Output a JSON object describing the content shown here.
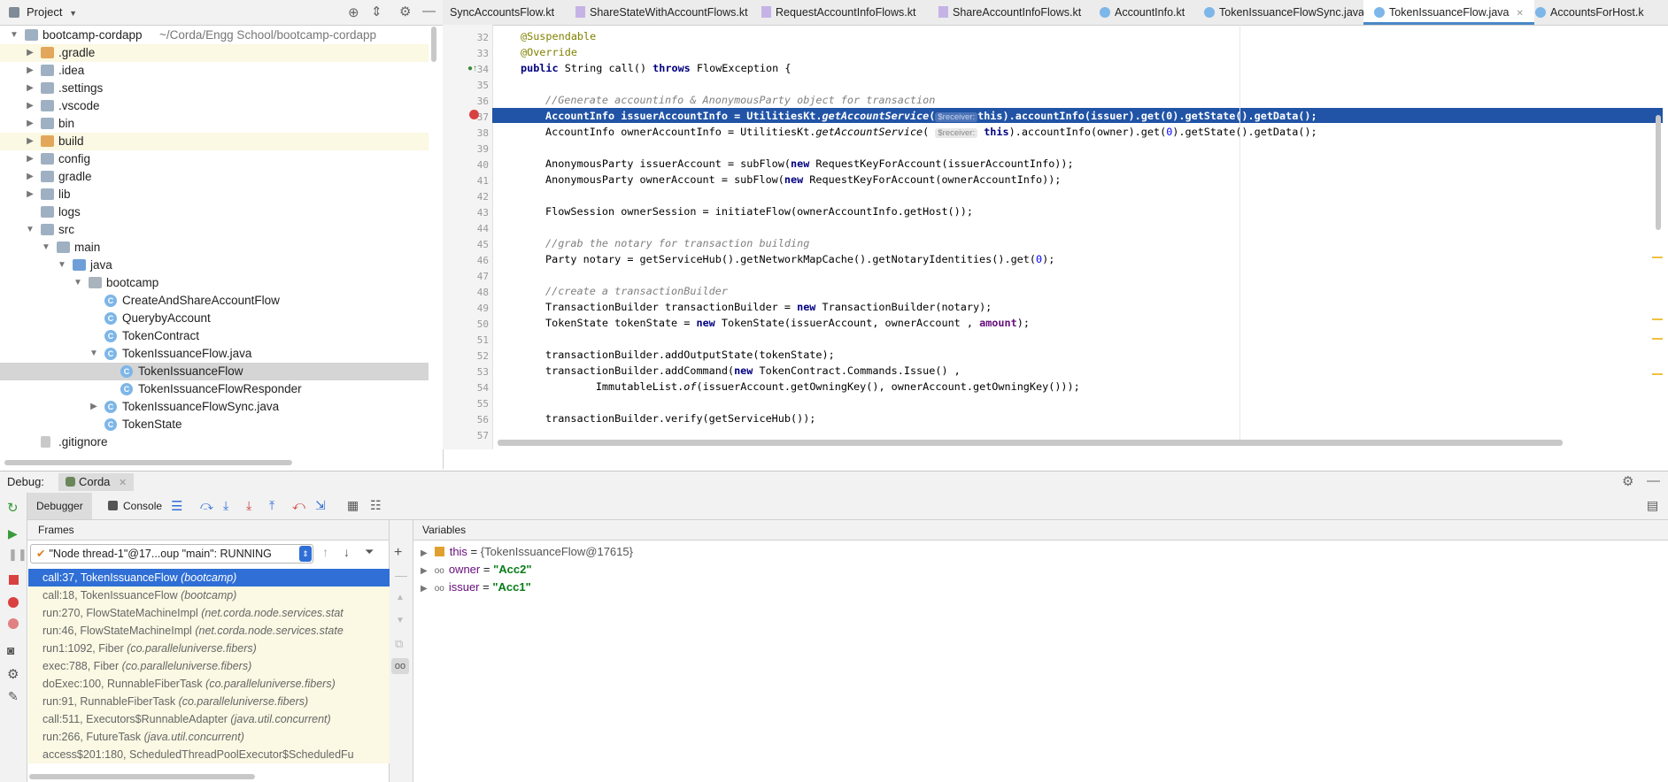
{
  "project": {
    "title": "Project",
    "tree": [
      {
        "label": "bootcamp-cordapp",
        "extra": "~/Corda/Engg School/bootcamp-cordapp",
        "depth": 0,
        "open": true,
        "icon": "folder"
      },
      {
        "label": ".gradle",
        "depth": 1,
        "open": false,
        "icon": "folder-orange",
        "hl": true
      },
      {
        "label": ".idea",
        "depth": 1,
        "open": false,
        "icon": "folder"
      },
      {
        "label": ".settings",
        "depth": 1,
        "open": false,
        "icon": "folder"
      },
      {
        "label": ".vscode",
        "depth": 1,
        "open": false,
        "icon": "folder"
      },
      {
        "label": "bin",
        "depth": 1,
        "open": false,
        "icon": "folder"
      },
      {
        "label": "build",
        "depth": 1,
        "open": false,
        "icon": "folder-orange",
        "hl": true
      },
      {
        "label": "config",
        "depth": 1,
        "open": false,
        "icon": "folder"
      },
      {
        "label": "gradle",
        "depth": 1,
        "open": false,
        "icon": "folder"
      },
      {
        "label": "lib",
        "depth": 1,
        "open": false,
        "icon": "folder"
      },
      {
        "label": "logs",
        "depth": 1,
        "icon": "folder"
      },
      {
        "label": "src",
        "depth": 1,
        "open": true,
        "icon": "folder"
      },
      {
        "label": "main",
        "depth": 2,
        "open": true,
        "icon": "folder"
      },
      {
        "label": "java",
        "depth": 3,
        "open": true,
        "icon": "folder-blue"
      },
      {
        "label": "bootcamp",
        "depth": 4,
        "open": true,
        "icon": "folder-pkg"
      },
      {
        "label": "CreateAndShareAccountFlow",
        "depth": 5,
        "icon": "class"
      },
      {
        "label": "QuerybyAccount",
        "depth": 5,
        "icon": "class"
      },
      {
        "label": "TokenContract",
        "depth": 5,
        "icon": "class"
      },
      {
        "label": "TokenIssuanceFlow.java",
        "depth": 5,
        "open": true,
        "icon": "class"
      },
      {
        "label": "TokenIssuanceFlow",
        "depth": 6,
        "icon": "class",
        "sel": true
      },
      {
        "label": "TokenIssuanceFlowResponder",
        "depth": 6,
        "icon": "class"
      },
      {
        "label": "TokenIssuanceFlowSync.java",
        "depth": 5,
        "open": false,
        "icon": "class"
      },
      {
        "label": "TokenState",
        "depth": 5,
        "icon": "class"
      },
      {
        "label": ".gitignore",
        "depth": 1,
        "icon": "file"
      }
    ]
  },
  "tabs": [
    {
      "label": "SyncAccountsFlow.kt",
      "icon": "kt"
    },
    {
      "label": "ShareStateWithAccountFlows.kt",
      "icon": "kt"
    },
    {
      "label": "RequestAccountInfoFlows.kt",
      "icon": "kt"
    },
    {
      "label": "ShareAccountInfoFlows.kt",
      "icon": "kt"
    },
    {
      "label": "AccountInfo.kt",
      "icon": "class"
    },
    {
      "label": "TokenIssuanceFlowSync.java",
      "icon": "class"
    },
    {
      "label": "TokenIssuanceFlow.java",
      "icon": "class",
      "active": true
    },
    {
      "label": "AccountsForHost.k",
      "icon": "class"
    }
  ],
  "code": {
    "line_numbers": [
      "32",
      "33",
      "34",
      "35",
      "36",
      "37",
      "38",
      "39",
      "40",
      "41",
      "42",
      "43",
      "44",
      "45",
      "46",
      "47",
      "48",
      "49",
      "50",
      "51",
      "52",
      "53",
      "54",
      "55",
      "56",
      "57"
    ],
    "l32": "@Suspendable",
    "l33": "@Override",
    "l34_kw1": "public",
    "l34_rest": " String call() ",
    "l34_kw2": "throws",
    "l34_end": " FlowException {",
    "l36": "//Generate accountinfo & AnonymousParty object for transaction",
    "l37_a": "AccountInfo issuerAccountInfo = UtilitiesKt.",
    "l37_b": "getAccountService",
    "l37_hint": "$receiver:",
    "l37_c": "this",
    "l37_d": ").accountInfo(issuer).get(0).getState().getData();",
    "l38_a": "AccountInfo ownerAccountInfo = UtilitiesKt.",
    "l38_b": "getAccountService",
    "l38_hint": "$receiver:",
    "l38_c": "this",
    "l38_d": ").accountInfo(owner).get(",
    "l38_num": "0",
    "l38_e": ").getState().getData();",
    "l40_a": "AnonymousParty issuerAccount = subFlow(",
    "l40_kw": "new",
    "l40_b": " RequestKeyForAccount(issuerAccountInfo));",
    "l41_a": "AnonymousParty ownerAccount = subFlow(",
    "l41_kw": "new",
    "l41_b": " RequestKeyForAccount(ownerAccountInfo));",
    "l43": "FlowSession ownerSession = initiateFlow(ownerAccountInfo.getHost());",
    "l45": "//grab the notary for transaction building",
    "l46_a": "Party notary = getServiceHub().getNetworkMapCache().getNotaryIdentities().get(",
    "l46_num": "0",
    "l46_b": ");",
    "l48": "//create a transactionBuilder",
    "l49_a": "TransactionBuilder transactionBuilder = ",
    "l49_kw": "new",
    "l49_b": " TransactionBuilder(notary);",
    "l50_a": "TokenState tokenState = ",
    "l50_kw": "new",
    "l50_b": " TokenState(issuerAccount, ownerAccount , ",
    "l50_fld": "amount",
    "l50_c": ");",
    "l52": "transactionBuilder.addOutputState(tokenState);",
    "l53_a": "transactionBuilder.addCommand(",
    "l53_kw": "new",
    "l53_b": " TokenContract.Commands.Issue() ,",
    "l54_a": "        ImmutableList.",
    "l54_it": "of",
    "l54_b": "(issuerAccount.getOwningKey(), ownerAccount.getOwningKey()));",
    "l56": "transactionBuilder.verify(getServiceHub());"
  },
  "debug": {
    "label": "Debug:",
    "config": "Corda",
    "tab_debugger": "Debugger",
    "tab_console": "Console",
    "frames_title": "Frames",
    "variables_title": "Variables",
    "thread": "\"Node thread-1\"@17...oup \"main\": RUNNING",
    "frames": [
      {
        "method": "call:37, TokenIssuanceFlow",
        "pkg": "(bootcamp)",
        "active": true
      },
      {
        "method": "call:18, TokenIssuanceFlow",
        "pkg": "(bootcamp)"
      },
      {
        "method": "run:270, FlowStateMachineImpl",
        "pkg": "(net.corda.node.services.stat"
      },
      {
        "method": "run:46, FlowStateMachineImpl",
        "pkg": "(net.corda.node.services.state"
      },
      {
        "method": "run1:1092, Fiber",
        "pkg": "(co.paralleluniverse.fibers)"
      },
      {
        "method": "exec:788, Fiber",
        "pkg": "(co.paralleluniverse.fibers)"
      },
      {
        "method": "doExec:100, RunnableFiberTask",
        "pkg": "(co.paralleluniverse.fibers)"
      },
      {
        "method": "run:91, RunnableFiberTask",
        "pkg": "(co.paralleluniverse.fibers)"
      },
      {
        "method": "call:511, Executors$RunnableAdapter",
        "pkg": "(java.util.concurrent)"
      },
      {
        "method": "run:266, FutureTask",
        "pkg": "(java.util.concurrent)"
      },
      {
        "method": "access$201:180, ScheduledThreadPoolExecutor$ScheduledFu",
        "pkg": ""
      }
    ],
    "variables": [
      {
        "name": "this",
        "eq": " = ",
        "value": "{TokenIssuanceFlow@17615}",
        "kind": "obj"
      },
      {
        "name": "owner",
        "eq": " = ",
        "value": "\"Acc2\"",
        "kind": "str"
      },
      {
        "name": "issuer",
        "eq": " = ",
        "value": "\"Acc1\"",
        "kind": "str"
      }
    ]
  }
}
